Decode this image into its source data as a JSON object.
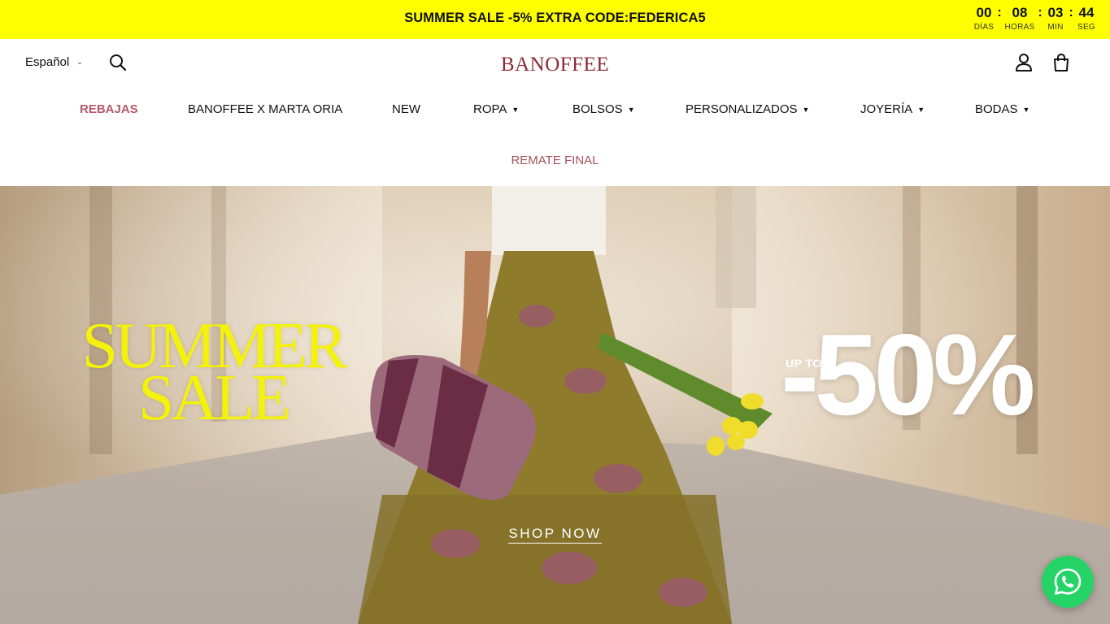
{
  "announcement": {
    "text": "SUMMER SALE -5% EXTRA CODE:FEDERICA5",
    "countdown": [
      {
        "value": "00",
        "label": "DÍAS"
      },
      {
        "value": "08",
        "label": "HORAS"
      },
      {
        "value": "03",
        "label": "MIN"
      },
      {
        "value": "44",
        "label": "SEG"
      }
    ],
    "separator": ":",
    "bg_color": "#ffff00"
  },
  "header": {
    "language": "Español",
    "logo": "BANOFFEE",
    "icons": [
      "search-icon",
      "account-icon",
      "cart-icon"
    ]
  },
  "nav": {
    "items": [
      {
        "label": "REBAJAS"
      },
      {
        "label": "BANOFFEE X MARTA ORIA"
      },
      {
        "label": "NEW"
      },
      {
        "label": "ROPA"
      },
      {
        "label": "BOLSOS"
      },
      {
        "label": "PERSONALIZADOS"
      },
      {
        "label": "JOYERÍA"
      },
      {
        "label": "BODAS"
      }
    ],
    "second_row": "REMATE FINAL",
    "sale_color": "#b45a6a"
  },
  "hero": {
    "title_line1": "SUMMER",
    "title_line2": "SALE",
    "up_to": "UP TO",
    "discount": "-50%",
    "cta": "SHOP NOW"
  },
  "floating": {
    "whatsapp_icon": "whatsapp-icon",
    "color": "#25d366"
  }
}
